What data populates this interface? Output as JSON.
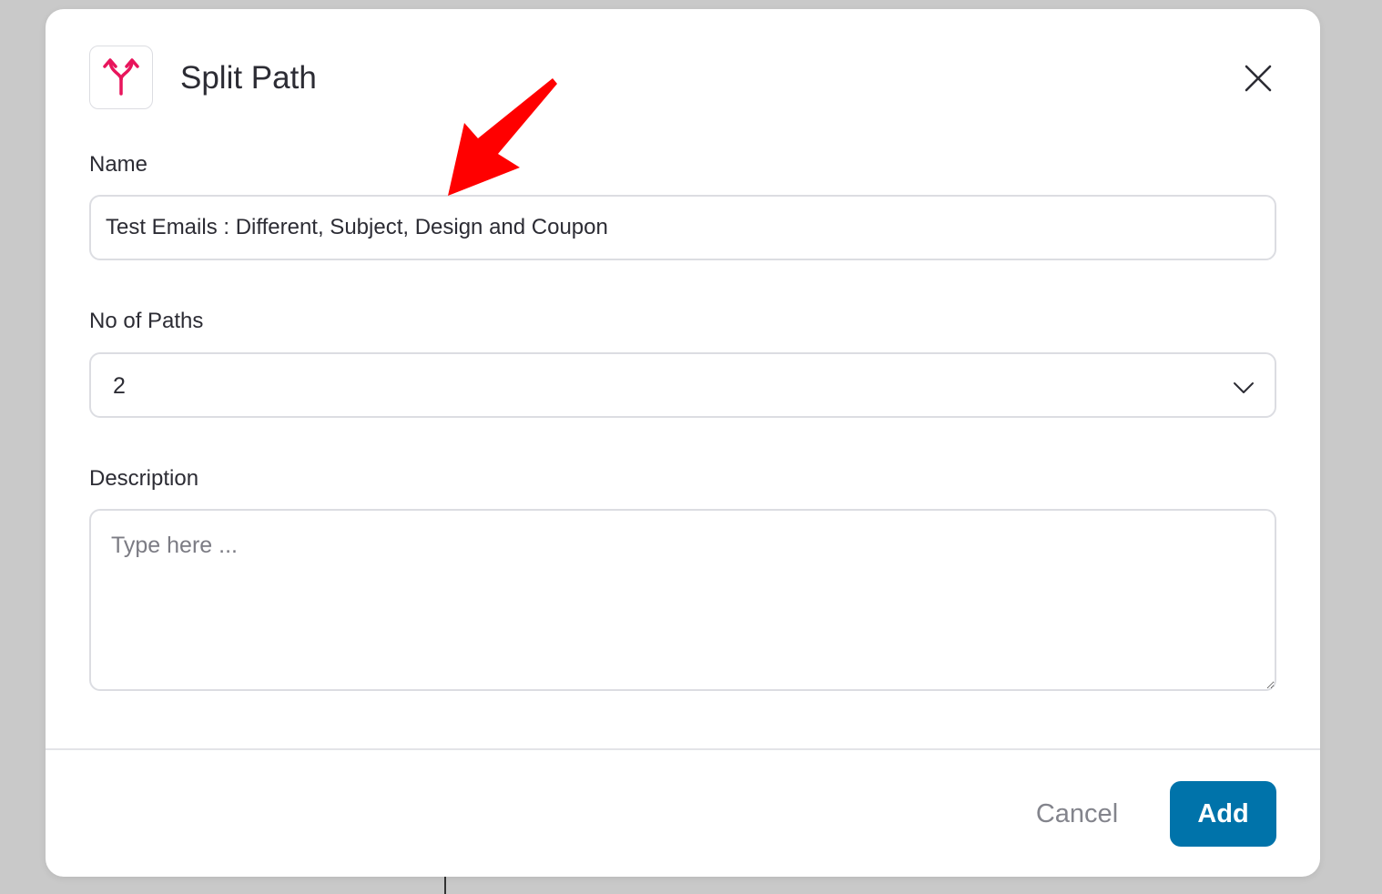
{
  "modal": {
    "title": "Split Path",
    "icon": "split-path-icon",
    "close_icon": "close-icon"
  },
  "form": {
    "name_label": "Name",
    "name_value": "Test Emails : Different, Subject, Design and Coupon",
    "paths_label": "No of Paths",
    "paths_value": "2",
    "description_label": "Description",
    "description_placeholder": "Type here ..."
  },
  "footer": {
    "cancel_label": "Cancel",
    "add_label": "Add"
  },
  "colors": {
    "accent": "#e8155c",
    "primary_button": "#0073aa",
    "annotation_arrow": "#ff0000"
  }
}
